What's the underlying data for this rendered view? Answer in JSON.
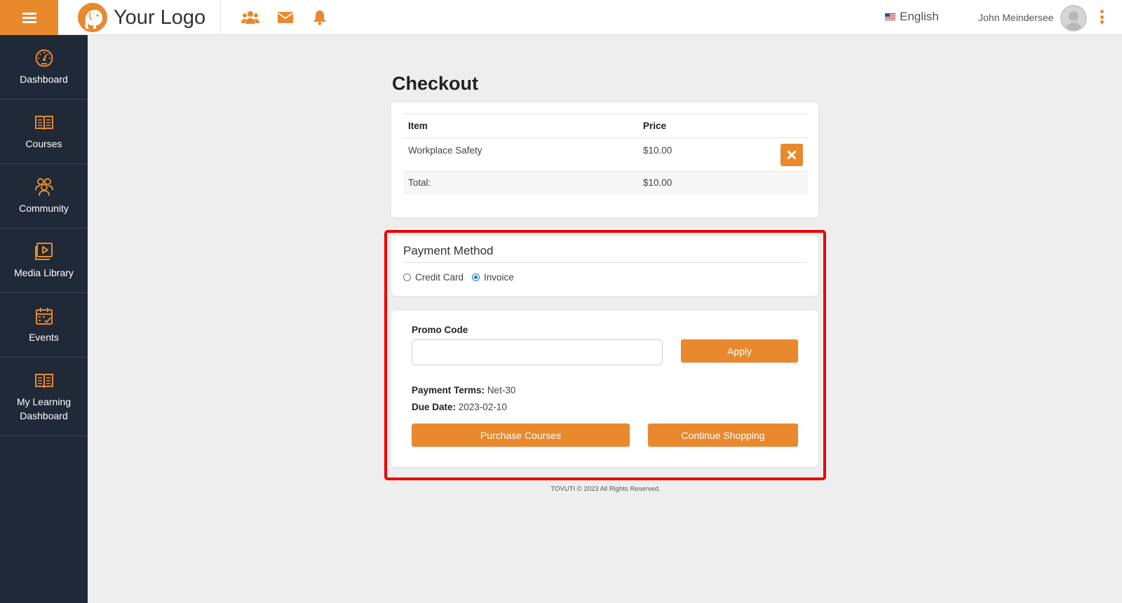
{
  "header": {
    "logo_text": "Your Logo",
    "language": "English",
    "user_name": "John Meindersee"
  },
  "sidebar": {
    "items": [
      {
        "label": "Dashboard",
        "icon": "dashboard-icon"
      },
      {
        "label": "Courses",
        "icon": "book-icon"
      },
      {
        "label": "Community",
        "icon": "community-icon"
      },
      {
        "label": "Media Library",
        "icon": "media-library-icon"
      },
      {
        "label": "Events",
        "icon": "calendar-icon"
      },
      {
        "label": "My Learning Dashboard",
        "icon": "book-icon"
      }
    ]
  },
  "checkout": {
    "title": "Checkout",
    "columns": [
      "Item",
      "Price"
    ],
    "items": [
      {
        "name": "Workplace Safety",
        "price": "$10.00"
      }
    ],
    "total_label": "Total:",
    "total_value": "$10.00"
  },
  "payment": {
    "title": "Payment Method",
    "options": [
      "Credit Card",
      "Invoice"
    ],
    "selected": "Invoice"
  },
  "promo": {
    "label": "Promo Code",
    "value": "",
    "apply_label": "Apply",
    "terms_label": "Payment Terms:",
    "terms_value": "Net-30",
    "due_label": "Due Date:",
    "due_value": "2023-02-10",
    "purchase_label": "Purchase Courses",
    "continue_label": "Continue Shopping"
  },
  "footer": {
    "text": "TOVUTI © 2023 All Rights Reserved."
  },
  "colors": {
    "accent": "#e8892e",
    "sidebar_bg": "#1f2937",
    "highlight": "#ee0000"
  }
}
